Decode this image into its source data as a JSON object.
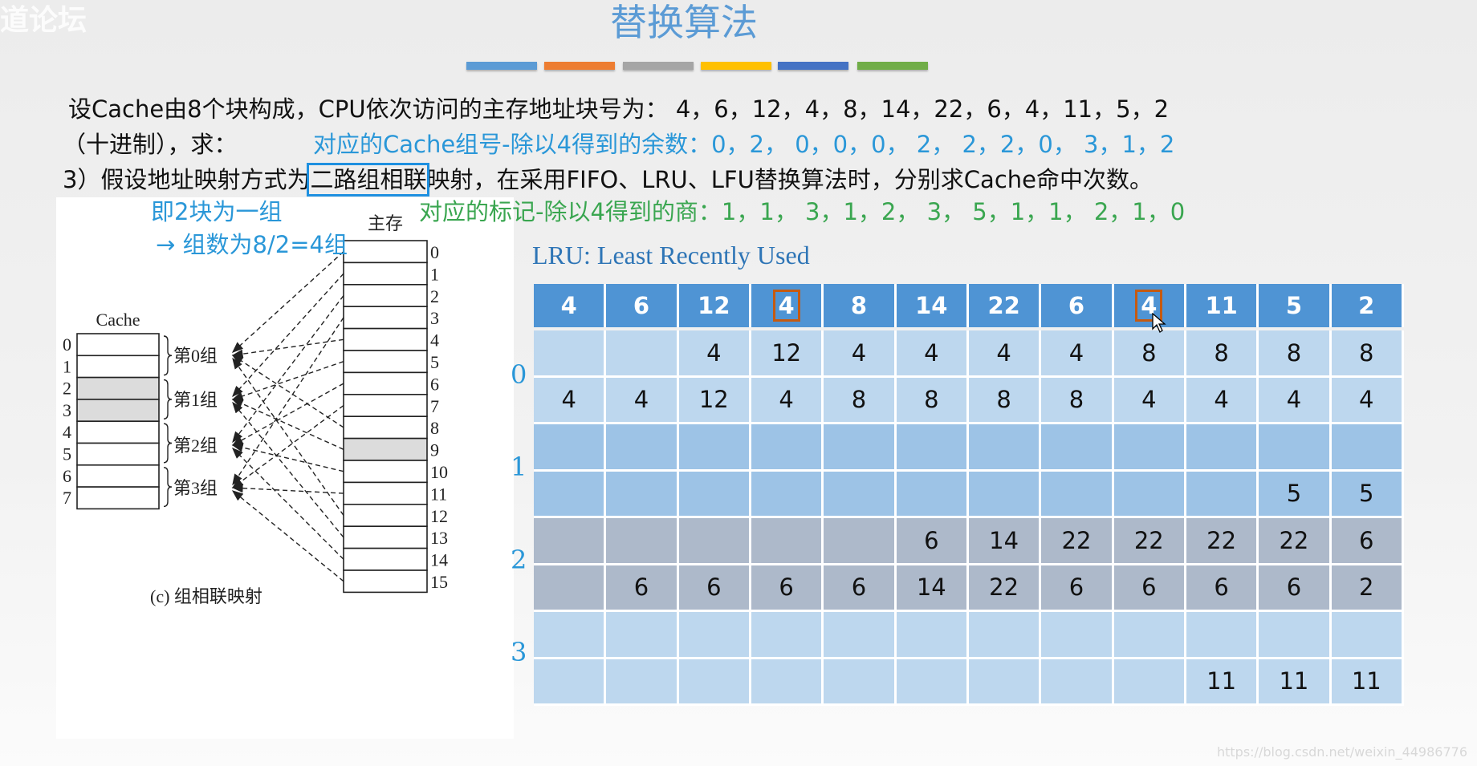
{
  "watermark_top": "道论坛",
  "title": "替换算法",
  "title_bars": [
    "#5b9bd5",
    "#ed7d31",
    "#a5a5a5",
    "#ffc000",
    "#4472c4",
    "#70ad47"
  ],
  "text": {
    "line1": "设Cache由8个块构成，CPU依次访问的主存地址块号为： 4，6，12，4，8，14，22，6，4，11，5，2",
    "line2_a": "（十进制），求：",
    "line2_b": "对应的Cache组号-除以4得到的余数：0，2，  0，0，0，  2，  2，2，0，  3，1，2",
    "line3_a": "3）假设地址映射方式为",
    "line3_box": "二路组相联",
    "line3_b": "映射，在采用FIFO、LRU、LFU替换算法时，分别求Cache命中次数。",
    "note1": "即2块为一组",
    "note_tag": "对应的标记-除以4得到的商：1，1，  3，1，2，  3，  5，1，1，  2，1，0",
    "note2": "→ 组数为8/2=4组"
  },
  "diagram": {
    "cache_label": "Cache",
    "memory_label": "主存",
    "cache_indices": [
      "0",
      "1",
      "2",
      "3",
      "4",
      "5",
      "6",
      "7"
    ],
    "memory_indices": [
      "0",
      "1",
      "2",
      "3",
      "4",
      "5",
      "6",
      "7",
      "8",
      "9",
      "10",
      "11",
      "12",
      "13",
      "14",
      "15"
    ],
    "groups": [
      "第0组",
      "第1组",
      "第2组",
      "第3组"
    ],
    "caption": "(c) 组相联映射"
  },
  "lru_label": "LRU:   Least Recently Used",
  "group_labels": [
    "0",
    "1",
    "2",
    "3"
  ],
  "table": {
    "header": [
      "4",
      "6",
      "12",
      "4",
      "8",
      "14",
      "22",
      "6",
      "4",
      "11",
      "5",
      "2"
    ],
    "highlighted_columns": [
      3,
      8
    ],
    "rows": [
      [
        "",
        "",
        "4",
        "12",
        "4",
        "4",
        "4",
        "4",
        "8",
        "8",
        "8",
        "8"
      ],
      [
        "4",
        "4",
        "12",
        "4",
        "8",
        "8",
        "8",
        "8",
        "4",
        "4",
        "4",
        "4"
      ],
      [
        "",
        "",
        "",
        "",
        "",
        "",
        "",
        "",
        "",
        "",
        "",
        ""
      ],
      [
        "",
        "",
        "",
        "",
        "",
        "",
        "",
        "",
        "",
        "",
        "5",
        "5"
      ],
      [
        "",
        "",
        "",
        "",
        "",
        "6",
        "14",
        "22",
        "22",
        "22",
        "22",
        "6"
      ],
      [
        "",
        "6",
        "6",
        "6",
        "6",
        "14",
        "22",
        "6",
        "6",
        "6",
        "6",
        "2"
      ],
      [
        "",
        "",
        "",
        "",
        "",
        "",
        "",
        "",
        "",
        "",
        "",
        ""
      ],
      [
        "",
        "",
        "",
        "",
        "",
        "",
        "",
        "",
        "",
        "11",
        "11",
        "11"
      ]
    ]
  },
  "footer_watermark": "https://blog.csdn.net/weixin_44986776"
}
